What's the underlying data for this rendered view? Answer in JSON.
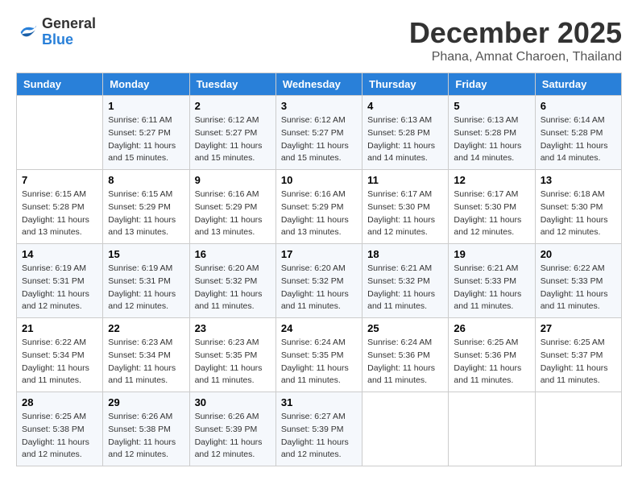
{
  "logo": {
    "general": "General",
    "blue": "Blue"
  },
  "title": {
    "month_year": "December 2025",
    "location": "Phana, Amnat Charoen, Thailand"
  },
  "weekdays": [
    "Sunday",
    "Monday",
    "Tuesday",
    "Wednesday",
    "Thursday",
    "Friday",
    "Saturday"
  ],
  "weeks": [
    [
      {
        "day": "",
        "sunrise": "",
        "sunset": "",
        "daylight": ""
      },
      {
        "day": "1",
        "sunrise": "6:11 AM",
        "sunset": "5:27 PM",
        "daylight": "11 hours and 15 minutes."
      },
      {
        "day": "2",
        "sunrise": "6:12 AM",
        "sunset": "5:27 PM",
        "daylight": "11 hours and 15 minutes."
      },
      {
        "day": "3",
        "sunrise": "6:12 AM",
        "sunset": "5:27 PM",
        "daylight": "11 hours and 15 minutes."
      },
      {
        "day": "4",
        "sunrise": "6:13 AM",
        "sunset": "5:28 PM",
        "daylight": "11 hours and 14 minutes."
      },
      {
        "day": "5",
        "sunrise": "6:13 AM",
        "sunset": "5:28 PM",
        "daylight": "11 hours and 14 minutes."
      },
      {
        "day": "6",
        "sunrise": "6:14 AM",
        "sunset": "5:28 PM",
        "daylight": "11 hours and 14 minutes."
      }
    ],
    [
      {
        "day": "7",
        "sunrise": "6:15 AM",
        "sunset": "5:28 PM",
        "daylight": "11 hours and 13 minutes."
      },
      {
        "day": "8",
        "sunrise": "6:15 AM",
        "sunset": "5:29 PM",
        "daylight": "11 hours and 13 minutes."
      },
      {
        "day": "9",
        "sunrise": "6:16 AM",
        "sunset": "5:29 PM",
        "daylight": "11 hours and 13 minutes."
      },
      {
        "day": "10",
        "sunrise": "6:16 AM",
        "sunset": "5:29 PM",
        "daylight": "11 hours and 13 minutes."
      },
      {
        "day": "11",
        "sunrise": "6:17 AM",
        "sunset": "5:30 PM",
        "daylight": "11 hours and 12 minutes."
      },
      {
        "day": "12",
        "sunrise": "6:17 AM",
        "sunset": "5:30 PM",
        "daylight": "11 hours and 12 minutes."
      },
      {
        "day": "13",
        "sunrise": "6:18 AM",
        "sunset": "5:30 PM",
        "daylight": "11 hours and 12 minutes."
      }
    ],
    [
      {
        "day": "14",
        "sunrise": "6:19 AM",
        "sunset": "5:31 PM",
        "daylight": "11 hours and 12 minutes."
      },
      {
        "day": "15",
        "sunrise": "6:19 AM",
        "sunset": "5:31 PM",
        "daylight": "11 hours and 12 minutes."
      },
      {
        "day": "16",
        "sunrise": "6:20 AM",
        "sunset": "5:32 PM",
        "daylight": "11 hours and 11 minutes."
      },
      {
        "day": "17",
        "sunrise": "6:20 AM",
        "sunset": "5:32 PM",
        "daylight": "11 hours and 11 minutes."
      },
      {
        "day": "18",
        "sunrise": "6:21 AM",
        "sunset": "5:32 PM",
        "daylight": "11 hours and 11 minutes."
      },
      {
        "day": "19",
        "sunrise": "6:21 AM",
        "sunset": "5:33 PM",
        "daylight": "11 hours and 11 minutes."
      },
      {
        "day": "20",
        "sunrise": "6:22 AM",
        "sunset": "5:33 PM",
        "daylight": "11 hours and 11 minutes."
      }
    ],
    [
      {
        "day": "21",
        "sunrise": "6:22 AM",
        "sunset": "5:34 PM",
        "daylight": "11 hours and 11 minutes."
      },
      {
        "day": "22",
        "sunrise": "6:23 AM",
        "sunset": "5:34 PM",
        "daylight": "11 hours and 11 minutes."
      },
      {
        "day": "23",
        "sunrise": "6:23 AM",
        "sunset": "5:35 PM",
        "daylight": "11 hours and 11 minutes."
      },
      {
        "day": "24",
        "sunrise": "6:24 AM",
        "sunset": "5:35 PM",
        "daylight": "11 hours and 11 minutes."
      },
      {
        "day": "25",
        "sunrise": "6:24 AM",
        "sunset": "5:36 PM",
        "daylight": "11 hours and 11 minutes."
      },
      {
        "day": "26",
        "sunrise": "6:25 AM",
        "sunset": "5:36 PM",
        "daylight": "11 hours and 11 minutes."
      },
      {
        "day": "27",
        "sunrise": "6:25 AM",
        "sunset": "5:37 PM",
        "daylight": "11 hours and 11 minutes."
      }
    ],
    [
      {
        "day": "28",
        "sunrise": "6:25 AM",
        "sunset": "5:38 PM",
        "daylight": "11 hours and 12 minutes."
      },
      {
        "day": "29",
        "sunrise": "6:26 AM",
        "sunset": "5:38 PM",
        "daylight": "11 hours and 12 minutes."
      },
      {
        "day": "30",
        "sunrise": "6:26 AM",
        "sunset": "5:39 PM",
        "daylight": "11 hours and 12 minutes."
      },
      {
        "day": "31",
        "sunrise": "6:27 AM",
        "sunset": "5:39 PM",
        "daylight": "11 hours and 12 minutes."
      },
      {
        "day": "",
        "sunrise": "",
        "sunset": "",
        "daylight": ""
      },
      {
        "day": "",
        "sunrise": "",
        "sunset": "",
        "daylight": ""
      },
      {
        "day": "",
        "sunrise": "",
        "sunset": "",
        "daylight": ""
      }
    ]
  ]
}
